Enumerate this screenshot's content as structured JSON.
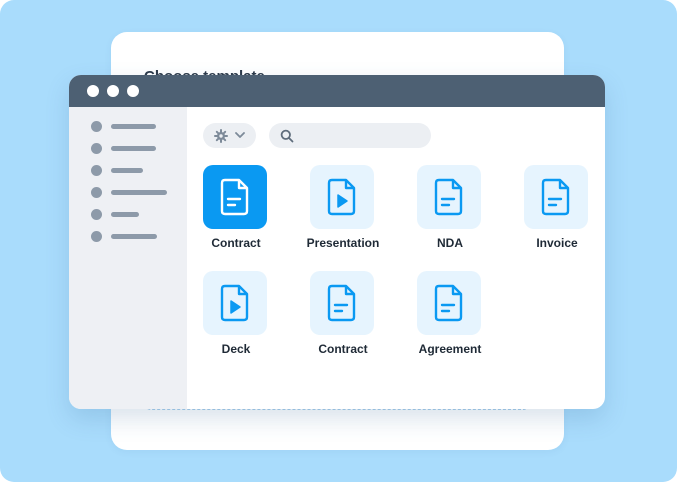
{
  "background_document": {
    "title": "Choose template"
  },
  "window": {
    "titlebar_dots": 3,
    "sidebar": {
      "item_count": 6
    },
    "toolbar": {
      "settings_icon": "gear-icon",
      "dropdown_icon": "chevron-down-icon",
      "search_icon": "search-icon"
    },
    "files": [
      {
        "label": "Contract",
        "icon": "document-icon",
        "selected": true
      },
      {
        "label": "Presentation",
        "icon": "video-file-icon",
        "selected": false
      },
      {
        "label": "NDA",
        "icon": "document-icon",
        "selected": false
      },
      {
        "label": "Invoice",
        "icon": "document-icon",
        "selected": false
      },
      {
        "label": "Deck",
        "icon": "video-file-icon",
        "selected": false
      },
      {
        "label": "Contract",
        "icon": "document-icon",
        "selected": false
      },
      {
        "label": "Agreement",
        "icon": "document-icon",
        "selected": false
      }
    ]
  },
  "colors": {
    "background": "#a9dcfc",
    "titlebar": "#4d6073",
    "accent": "#0a99f2",
    "tile": "#e6f4fe",
    "sidebar": "#eef0f4"
  }
}
